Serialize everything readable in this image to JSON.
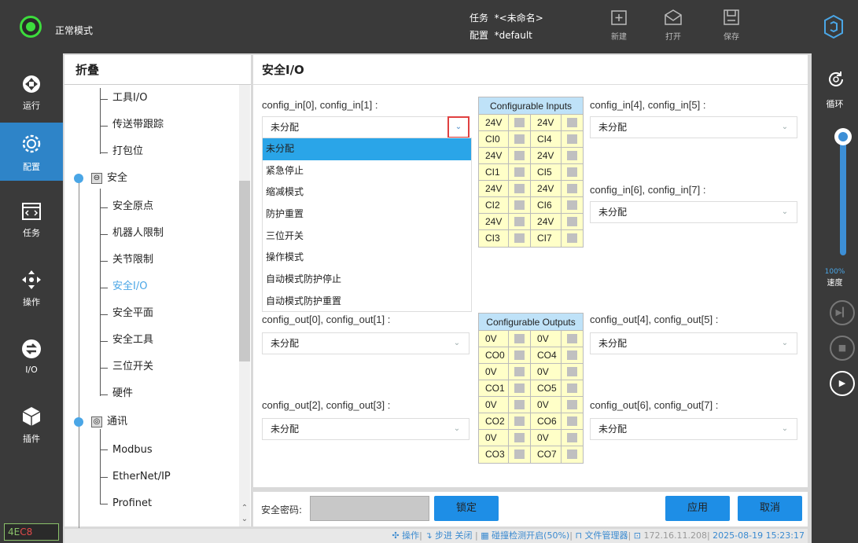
{
  "topbar": {
    "mode": "正常模式",
    "task_label": "任务",
    "task_value": "*<未命名>",
    "config_label": "配置",
    "config_value": "*default",
    "new_label": "新建",
    "open_label": "打开",
    "save_label": "保存"
  },
  "leftnav": {
    "run": "运行",
    "config": "配置",
    "task": "任务",
    "operate": "操作",
    "io": "I/O",
    "plugin": "插件",
    "version_a": "4E",
    "version_b": "C8"
  },
  "tree": {
    "title": "折叠",
    "tool_io": "工具I/O",
    "conveyor": "传送带跟踪",
    "pallet": "打包位",
    "safety": "安全",
    "safety_home": "安全原点",
    "robot_limits": "机器人限制",
    "joint_limits": "关节限制",
    "safety_io": "安全I/O",
    "safety_plane": "安全平面",
    "safety_tool": "安全工具",
    "three_pos": "三位开关",
    "hardware": "硬件",
    "comm": "通讯",
    "modbus": "Modbus",
    "ethernetip": "EtherNet/IP",
    "profinet": "Profinet"
  },
  "main": {
    "title": "安全I/O",
    "cfg_in01": "config_in[0], config_in[1] :",
    "cfg_in45": "config_in[4], config_in[5] :",
    "cfg_in67": "config_in[6], config_in[7] :",
    "cfg_out01": "config_out[0], config_out[1] :",
    "cfg_out23": "config_out[2], config_out[3] :",
    "cfg_out45": "config_out[4], config_out[5] :",
    "cfg_out67": "config_out[6], config_out[7] :",
    "unassigned": "未分配",
    "inputs_title": "Configurable Inputs",
    "outputs_title": "Configurable Outputs",
    "dropdown_options": [
      "未分配",
      "紧急停止",
      "缩减模式",
      "防护重置",
      "三位开关",
      "操作模式",
      "自动模式防护停止",
      "自动模式防护重置"
    ],
    "inputs_rows": [
      [
        "24V",
        "24V"
      ],
      [
        "CI0",
        "CI4"
      ],
      [
        "24V",
        "24V"
      ],
      [
        "CI1",
        "CI5"
      ],
      [
        "24V",
        "24V"
      ],
      [
        "CI2",
        "CI6"
      ],
      [
        "24V",
        "24V"
      ],
      [
        "CI3",
        "CI7"
      ]
    ],
    "outputs_rows": [
      [
        "0V",
        "0V"
      ],
      [
        "CO0",
        "CO4"
      ],
      [
        "0V",
        "0V"
      ],
      [
        "CO1",
        "CO5"
      ],
      [
        "0V",
        "0V"
      ],
      [
        "CO2",
        "CO6"
      ],
      [
        "0V",
        "0V"
      ],
      [
        "CO3",
        "CO7"
      ]
    ]
  },
  "bottom": {
    "password_label": "安全密码:",
    "lock": "锁定",
    "apply": "应用",
    "cancel": "取消"
  },
  "status": {
    "operate": "操作",
    "step": "步进 关闭",
    "collision": "碰撞检测开启(50%)",
    "files": "文件管理器",
    "ip": "172.16.11.208",
    "time": "2025-08-19 15:23:17"
  },
  "rightbar": {
    "loop": "循环",
    "speed_pct": "100%",
    "speed_label": "速度",
    "speed_value": 1.0
  }
}
